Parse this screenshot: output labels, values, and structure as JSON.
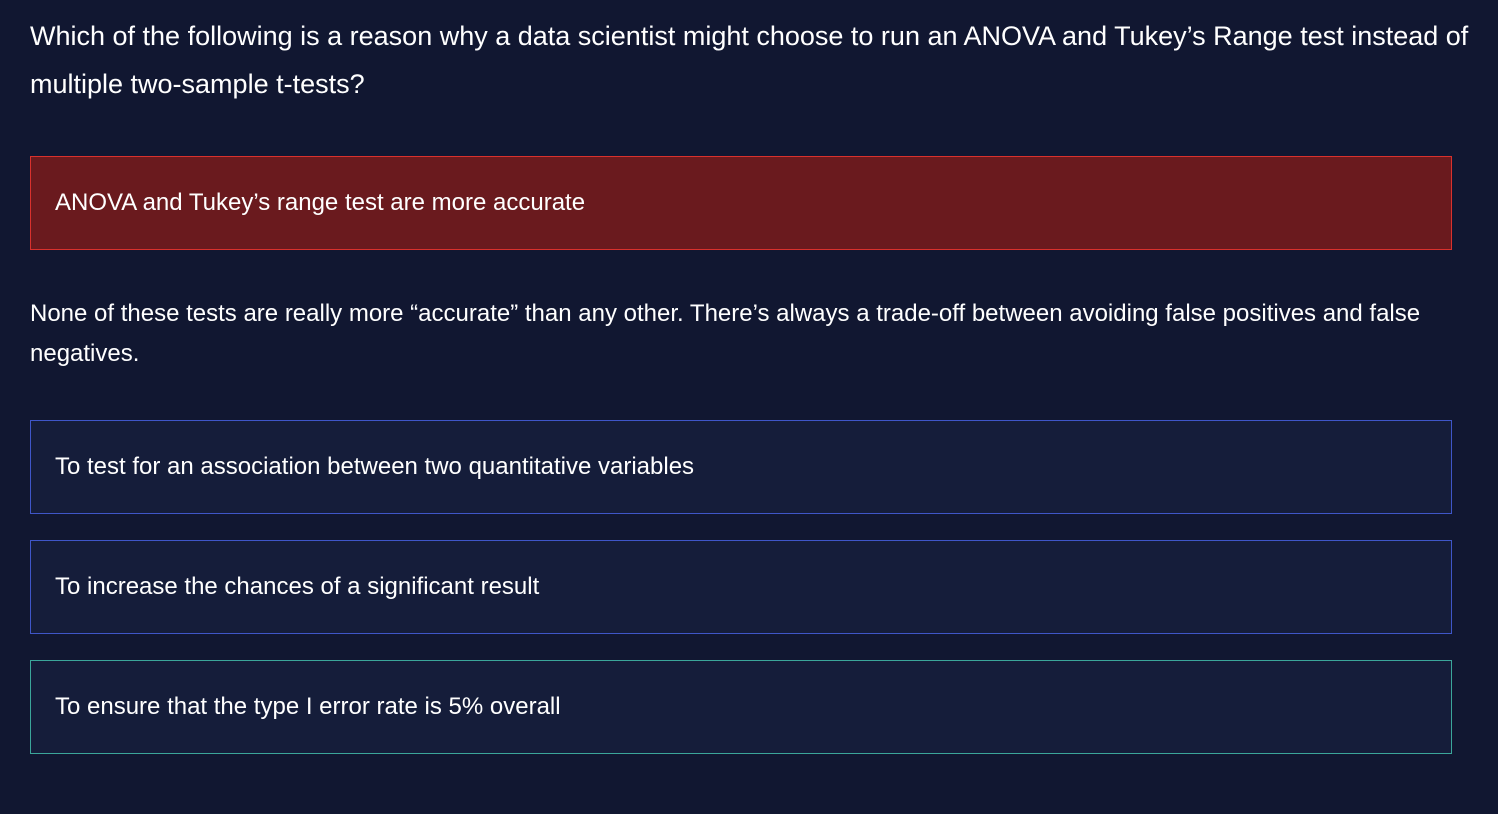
{
  "question": {
    "text": "Which of the following is a reason why a data scientist might choose to run an ANOVA and Tukey’s Range test instead of multiple two-sample t-tests?"
  },
  "options": [
    {
      "label": "ANOVA and Tukey’s range test are more accurate",
      "state": "incorrect-selected"
    },
    {
      "label": "To test for an association between two quantitative variables",
      "state": "unselected"
    },
    {
      "label": "To increase the chances of a significant result",
      "state": "unselected"
    },
    {
      "label": "To ensure that the type I error rate is 5% overall",
      "state": "correct"
    }
  ],
  "feedback": {
    "text": "None of these tests are really more “accurate” than any other. There’s always a trade-off between avoiding false positives and false negatives."
  },
  "colors": {
    "background": "#111731",
    "incorrect_fill": "#6a1a1e",
    "incorrect_border": "#d9312d",
    "option_fill": "#151d3a",
    "option_border": "#3f56c8",
    "correct_border": "#3ba69a"
  }
}
